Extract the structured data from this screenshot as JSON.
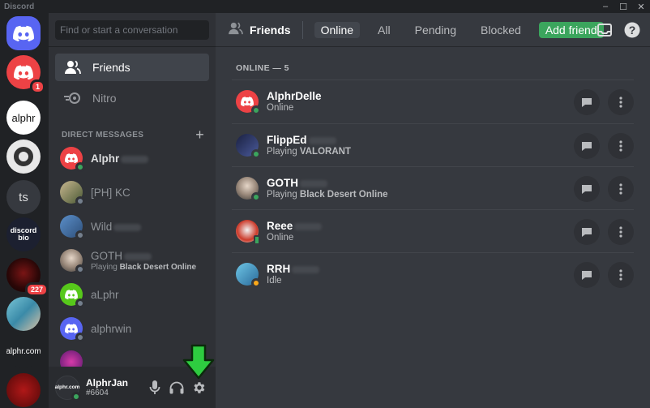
{
  "window": {
    "title": "Discord",
    "controls": [
      "–",
      "☐",
      "✕"
    ]
  },
  "servers": [
    {
      "name": "home",
      "label": "",
      "badge": ""
    },
    {
      "name": "server-discord-red",
      "label": "",
      "badge": "1"
    },
    {
      "name": "server-alphr",
      "label": "alphr",
      "badge": ""
    },
    {
      "name": "server-ring",
      "label": "",
      "badge": ""
    },
    {
      "name": "server-ts",
      "label": "ts",
      "badge": ""
    },
    {
      "name": "server-discord-bio",
      "label": "discord bio",
      "badge": ""
    },
    {
      "name": "server-red-art",
      "label": "",
      "badge": "227"
    },
    {
      "name": "server-photo",
      "label": "",
      "badge": ""
    },
    {
      "name": "server-alphr-com",
      "label": "alphr.com",
      "badge": ""
    },
    {
      "name": "server-red-logo",
      "label": "",
      "badge": ""
    }
  ],
  "search": {
    "placeholder": "Find or start a conversation"
  },
  "nav": {
    "friends": "Friends",
    "nitro": "Nitro"
  },
  "dm_header": {
    "label": "DIRECT MESSAGES",
    "add": "+"
  },
  "dms": [
    {
      "name": "Alphr",
      "sub": "",
      "sub_bold": "",
      "status": "on"
    },
    {
      "name": "[PH] KC",
      "sub": "",
      "sub_bold": "",
      "status": "off"
    },
    {
      "name": "Wild",
      "sub": "",
      "sub_bold": "",
      "status": "off"
    },
    {
      "name": "GOTH",
      "sub": "Playing ",
      "sub_bold": "Black Desert Online",
      "status": "off"
    },
    {
      "name": "aLphr",
      "sub": "",
      "sub_bold": "",
      "status": "off"
    },
    {
      "name": "alphrwin",
      "sub": "",
      "sub_bold": "",
      "status": "off"
    }
  ],
  "user": {
    "name": "AlphrJan",
    "tag": "#6604",
    "avatar_text": "alphr.com"
  },
  "topbar": {
    "title": "Friends",
    "tabs": [
      "Online",
      "All",
      "Pending",
      "Blocked"
    ],
    "add_friend": "Add friend"
  },
  "online_header": "ONLINE — 5",
  "friends": [
    {
      "name": "AlphrDelle",
      "status_text": "Online",
      "activity": "",
      "status": "on"
    },
    {
      "name": "FlippEd",
      "status_text": "Playing ",
      "activity": "VALORANT",
      "status": "on"
    },
    {
      "name": "GOTH",
      "status_text": "Playing ",
      "activity": "Black Desert Online",
      "status": "on"
    },
    {
      "name": "Reee",
      "status_text": "Online",
      "activity": "",
      "status": "mobile"
    },
    {
      "name": "RRH",
      "status_text": "Idle",
      "activity": "",
      "status": "idle"
    }
  ],
  "colors": {
    "blurple": "#5865f2",
    "green": "#3ba55d",
    "red": "#ed4245",
    "arrow_green": "#2ecc40"
  }
}
